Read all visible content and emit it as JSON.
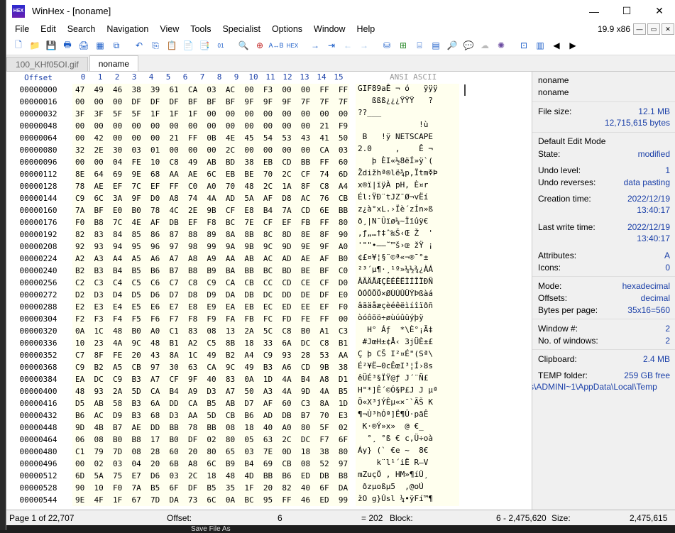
{
  "window": {
    "title": "WinHex - [noname]",
    "app_icon_text": "HEX"
  },
  "controls": {
    "minimize": "—",
    "maximize": "☐",
    "close": "✕"
  },
  "menu": [
    "File",
    "Edit",
    "Search",
    "Navigation",
    "View",
    "Tools",
    "Specialist",
    "Options",
    "Window",
    "Help"
  ],
  "version": "19.9 x86",
  "mdi": {
    "minimize": "—",
    "restore": "▭",
    "close": "✕"
  },
  "tabs": [
    {
      "label": "100_KHf05OI.gif",
      "active": false
    },
    {
      "label": "noname",
      "active": true
    }
  ],
  "hex": {
    "offset_label": "Offset",
    "columns": [
      "0",
      "1",
      "2",
      "3",
      "4",
      "5",
      "6",
      "7",
      "8",
      "9",
      "10",
      "11",
      "12",
      "13",
      "14",
      "15"
    ],
    "ascii_label": "ANSI ASCII",
    "rows": [
      {
        "off": "00000000",
        "b": "47 49 46 38 39 61 CA 03 AC 00 F3 00 00 FF FF FF",
        "a": "GIF89aÊ ¬ ó   ÿÿÿ"
      },
      {
        "off": "00000016",
        "b": "00 00 00 DF DF DF BF BF BF 9F 9F 9F 7F 7F 7F 3F",
        "a": "   ßßß¿¿¿ŸŸŸ   ?"
      },
      {
        "off": "00000032",
        "b": "3F 3F 5F 5F 1F 1F 1F 00 00 00 00 00 00 00 00 00",
        "a": "??___           "
      },
      {
        "off": "00000048",
        "b": "00 00 00 00 00 00 00 00 00 00 00 00 00 21 F9 04",
        "a": "             !ù "
      },
      {
        "off": "00000064",
        "b": "00 42 00 00 00 21 FF 0B 4E 45 54 53 43 41 50 45",
        "a": " B   !ÿ NETSCAPE"
      },
      {
        "off": "00000080",
        "b": "32 2E 30 03 01 00 00 00 2C 00 00 00 00 CA 03 AC",
        "a": "2.0     ,    Ê ¬"
      },
      {
        "off": "00000096",
        "b": "00 00 04 FE 10 C8 49 AB BD 38 EB CD BB FF 60 28",
        "a": "   þ ÈI«½8ëÍ»ÿ`("
      },
      {
        "off": "00000112",
        "b": "8E 64 69 9E 68 AA AE 6C EB BE 70 2C CF 74 6D DF",
        "a": "Ždižhª®lë¾p,ÏtmߧÞ"
      },
      {
        "off": "00000128",
        "b": "78 AE EF 7C EF FF C0 A0 70 48 2C 1A 8F C8 A4 72",
        "a": "x®ï|ïÿÀ pH, È¤r"
      },
      {
        "off": "00000144",
        "b": "C9 6C 3A 9F D0 A8 74 4A AD 5A AF D8 AC 76 CB ED",
        "a": "Él:ŸÐ¨tJ­Z¯Ø¬vËí"
      },
      {
        "off": "00000160",
        "b": "7A BF E0 B0 78 4C 2E 9B CF E8 B4 7A CD 6E BB DF",
        "a": "z¿à°xL.›Ïè´zÍn»ß"
      },
      {
        "off": "00000176",
        "b": "F0 B8 7C 4E AF DB EF F8 BC 7E CF EF FB FF 80 81",
        "a": "ð¸|N¯Ûïø¼~Ïïûÿ€ "
      },
      {
        "off": "00000192",
        "b": "82 83 84 85 86 87 88 89 8A 8B 8C 8D 8E 8F 90 91",
        "a": "‚ƒ„…†‡ˆ‰Š‹Œ Ž  '"
      },
      {
        "off": "00000208",
        "b": "92 93 94 95 96 97 98 99 9A 9B 9C 9D 9E 9F A0 A1",
        "a": "'\"\"•–—˜™š›œ žŸ ¡"
      },
      {
        "off": "00000224",
        "b": "A2 A3 A4 A5 A6 A7 A8 A9 AA AB AC AD AE AF B0 B1",
        "a": "¢£¤¥¦§¨©ª«¬­®¯°±"
      },
      {
        "off": "00000240",
        "b": "B2 B3 B4 B5 B6 B7 B8 B9 BA BB BC BD BE BF C0 C1",
        "a": "²³´µ¶·¸¹º»¼½¾¿ÀÁ"
      },
      {
        "off": "00000256",
        "b": "C2 C3 C4 C5 C6 C7 C8 C9 CA CB CC CD CE CF D0 D1",
        "a": "ÂÃÄÅÆÇÈÉÊËÌÍÎÏÐÑ"
      },
      {
        "off": "00000272",
        "b": "D2 D3 D4 D5 D6 D7 D8 D9 DA DB DC DD DE DF E0 E1",
        "a": "ÒÓÔÕÖ×ØÙÚÛÜÝÞßàá"
      },
      {
        "off": "00000288",
        "b": "E2 E3 E4 E5 E6 E7 E8 E9 EA EB EC ED EE EF F0 F1",
        "a": "âãäåæçèéêëìíîïðñ"
      },
      {
        "off": "00000304",
        "b": "F2 F3 F4 F5 F6 F7 F8 F9 FA FB FC FD FE FF 00 03",
        "a": "òóôõö÷øùúûüýþÿ  "
      },
      {
        "off": "00000320",
        "b": "0A 1C 48 B0 A0 C1 83 08 13 2A 5C C8 B0 A1 C3 87",
        "a": "  H° Áƒ  *\\È°¡Ã‡"
      },
      {
        "off": "00000336",
        "b": "10 23 4A 9C 48 B1 A2 C5 8B 18 33 6A DC C8 B1 A3",
        "a": " #JœH±¢Å‹ 3jÜÈ±£"
      },
      {
        "off": "00000352",
        "b": "C7 8F FE 20 43 8A 1C 49 B2 A4 C9 93 28 53 AA 5C",
        "a": "Ç þ CŠ I²¤É\"(Sª\\"
      },
      {
        "off": "00000368",
        "b": "C9 B2 A5 CB 97 30 63 CA 9C 49 B3 A6 CD 9B 38 73",
        "a": "É²¥Ë—0cÊœI³¦Í›8s"
      },
      {
        "off": "00000384",
        "b": "EA DC C9 B3 A7 CF 9F 40 83 0A 1D 4A B4 A8 D1 A3",
        "a": "êÜÉ³§ÏŸ@ƒ J´¨Ñ£"
      },
      {
        "off": "00000400",
        "b": "48 93 2A 5D CA B4 A9 D3 A7 50 A3 4A 9D 4A B5 AA",
        "a": "H\"*]Ê´©Ó§P£J J µª"
      },
      {
        "off": "00000416",
        "b": "D5 AB 58 B3 6A DD CA B5 AB D7 AF 60 C3 8A 1D 4B",
        "a": "Õ«X³jÝÊµ«×¯`ÃŠ K"
      },
      {
        "off": "00000432",
        "b": "B6 AC D9 B3 68 D3 AA 5D CB B6 AD DB B7 70 E3 CA",
        "a": "¶¬Ù³hÓª]Ë¶­Û·pãÊ"
      },
      {
        "off": "00000448",
        "b": "9D 4B B7 AE DD BB 78 BB 08 18 40 A0 80 5F 02 04",
        "a": " K·®Ý»x»  @ €_  "
      },
      {
        "off": "00000464",
        "b": "06 08 B0 B8 17 B0 DF 02 80 05 63 2C DC F7 6F E0",
        "a": "  °¸ °ß € c,Ü÷oà"
      },
      {
        "off": "00000480",
        "b": "C1 79 7D 08 28 60 20 80 65 03 7E 0D 18 38 80 20",
        "a": "Áy} (` €e ~  8€ "
      },
      {
        "off": "00000496",
        "b": "00 02 03 04 20 6B A8 6C B9 B4 69 CB 08 52 97 56",
        "a": "    k¨l¹´iË R—V"
      },
      {
        "off": "00000512",
        "b": "6D 5A 75 E7 D6 03 2C 18 48 4D BB B6 ED DB B8 0D",
        "a": "mZuçÖ , HM»¶íÛ¸ "
      },
      {
        "off": "00000528",
        "b": "90 10 F0 7A B5 6F DF B5 35 1F 20 82 40 6F DA",
        "a": " ðzµoßµ5  ‚@oÚ"
      },
      {
        "off": "00000544",
        "b": "9E 4F 1F 67 7D DA 73 6C 0A BC 95 FF 46 ED 99 B6",
        "a": "žO g}Úsl ¼•ÿFí™¶"
      }
    ]
  },
  "info": {
    "file_name": "noname",
    "file_name2": "noname",
    "file_size_label": "File size:",
    "file_size_mb": "12.1 MB",
    "file_size_bytes": "12,715,615 bytes",
    "edit_mode_label": "Default Edit Mode",
    "state_label": "State:",
    "state_value": "modified",
    "undo_level_label": "Undo level:",
    "undo_level_value": "1",
    "undo_reverses_label": "Undo reverses:",
    "undo_reverses_value": "data pasting",
    "creation_label": "Creation time:",
    "creation_date": "2022/12/19",
    "creation_time": "13:40:17",
    "write_label": "Last write time:",
    "write_date": "2022/12/19",
    "write_time": "13:40:17",
    "attributes_label": "Attributes:",
    "attributes_value": "A",
    "icons_label": "Icons:",
    "icons_value": "0",
    "mode_label": "Mode:",
    "mode_value": "hexadecimal",
    "offsets_label": "Offsets:",
    "offsets_value": "decimal",
    "bpp_label": "Bytes per page:",
    "bpp_value": "35x16=560",
    "window_no_label": "Window #:",
    "window_no_value": "2",
    "num_windows_label": "No. of windows:",
    "num_windows_value": "2",
    "clipboard_label": "Clipboard:",
    "clipboard_value": "2.4 MB",
    "temp_label": "TEMP folder:",
    "temp_value": "259 GB free",
    "temp_path": "s\\ADMINI~1\\AppData\\Local\\Temp"
  },
  "status": {
    "page": "Page 1 of 22,707",
    "offset_label": "Offset:",
    "offset_value": "6",
    "equals_value": "= 202",
    "block_label": "Block:",
    "block_value": "6 - 2,475,620",
    "size_label": "Size:",
    "size_value": "2,475,615"
  },
  "taskbar": {
    "item": "Save File As"
  }
}
